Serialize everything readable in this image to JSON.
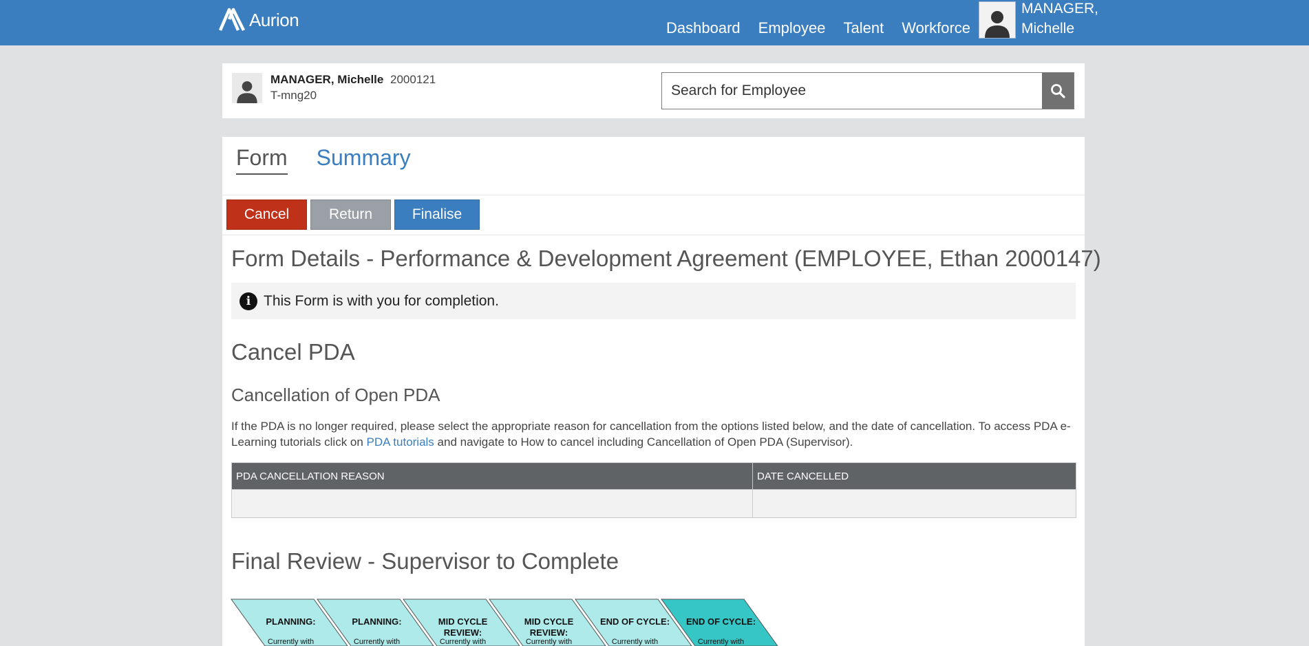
{
  "header": {
    "logo_text": "Aurion",
    "nav": [
      "Dashboard",
      "Employee",
      "Talent",
      "Workforce"
    ],
    "user_name_line1": "MANAGER,",
    "user_name_line2": "Michelle"
  },
  "employee": {
    "name": "MANAGER, Michelle",
    "id": "2000121",
    "login": "T-mng20"
  },
  "search": {
    "placeholder": "Search for Employee"
  },
  "tabs": {
    "form": "Form",
    "summary": "Summary"
  },
  "actions": {
    "cancel": "Cancel",
    "return": "Return",
    "finalise": "Finalise"
  },
  "form": {
    "title": "Form Details - Performance & Development Agreement (EMPLOYEE, Ethan 2000147)",
    "info": "This Form is with you for completion.",
    "cancel_heading": "Cancel PDA",
    "cancel_subheading": "Cancellation of Open PDA",
    "paragraph_before_link": "If the PDA is no longer required, please select the appropriate reason for cancellation from the options listed below, and the date of cancellation. To access PDA e-Learning tutorials click on ",
    "link_text": "PDA tutorials",
    "paragraph_after_link": " and navigate to How to cancel including Cancellation of Open PDA (Supervisor).",
    "table_headers": [
      "PDA CANCELLATION REASON",
      "DATE CANCELLED"
    ],
    "final_heading": "Final Review - Supervisor to Complete"
  },
  "stages": [
    {
      "label": "PLANNING:",
      "sub": "Currently with"
    },
    {
      "label": "PLANNING:",
      "sub": "Currently with"
    },
    {
      "label": "MID CYCLE REVIEW:",
      "sub": "Currently with"
    },
    {
      "label": "MID CYCLE REVIEW:",
      "sub": "Currently with"
    },
    {
      "label": "END OF CYCLE:",
      "sub": "Currently with"
    },
    {
      "label": "END OF CYCLE:",
      "sub": "Currently with"
    }
  ],
  "colors": {
    "brand": "#3a7ebf",
    "cancel": "#c0311a",
    "return": "#9aa0a5",
    "stage": "#aeeaea",
    "stage_active": "#36c6c6"
  }
}
